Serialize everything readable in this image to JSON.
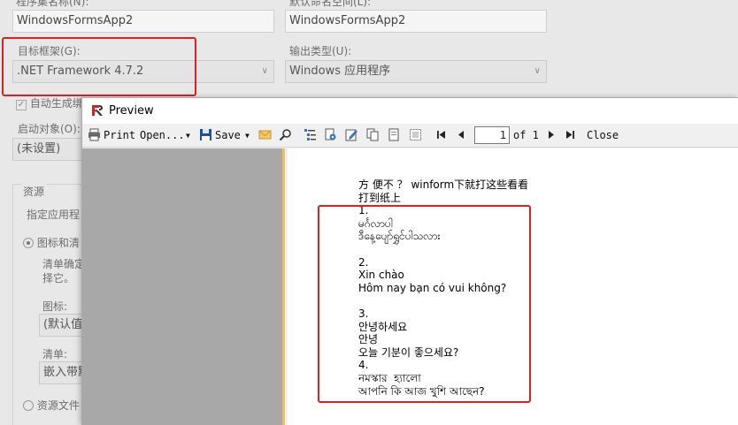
{
  "properties": {
    "assembly_name_label": "程序集名称(N):",
    "assembly_name_value": "WindowsFormsApp2",
    "default_namespace_label": "默认命名空间(L):",
    "default_namespace_value": "WindowsFormsApp2",
    "target_framework_label": "目标框架(G):",
    "target_framework_value": ".NET Framework 4.7.2",
    "output_type_label": "输出类型(U):",
    "output_type_value": "Windows 应用程序",
    "auto_generate_label": "自动生成绑",
    "startup_object_label": "启动对象(O):",
    "startup_object_value": "(未设置)",
    "resources_group_label": "资源",
    "specify_resources_label": "指定应用程",
    "icon_manifest_label": "图标和清",
    "manifest_desc_line1": "清单确定",
    "manifest_desc_line2": "择它。",
    "icon_label": "图标:",
    "icon_value": "(默认值:",
    "manifest_label": "清单:",
    "manifest_value": "嵌入带默",
    "resource_file_label": "资源文件"
  },
  "preview": {
    "window_title": "Preview",
    "toolbar": {
      "print_label": "Print",
      "open_label": "Open...",
      "save_label": "Save",
      "current_page": "1",
      "page_of": "of 1",
      "close_label": "Close"
    },
    "document_lines": [
      "方 便不 ？ winform下就打这些看看",
      "打到纸上",
      "1.",
      "မင်္ဂလာပါ",
      "ဒီနေ့ပျော်ရွှင်ပါသလား",
      "",
      "2.",
      "Xin chào",
      "Hôm nay bạn có vui không?",
      "",
      "3.",
      "안녕하세요",
      "안녕",
      "오늘 기분이 좋으세요?",
      "4.",
      "নমস্কার  হ্যালো",
      "আপনি কি আজ খুশি আছেন?"
    ]
  },
  "colors": {
    "highlight": "#e02020",
    "preview_sidebar": "#a8a8a8",
    "page_edge": "#e8c060"
  }
}
